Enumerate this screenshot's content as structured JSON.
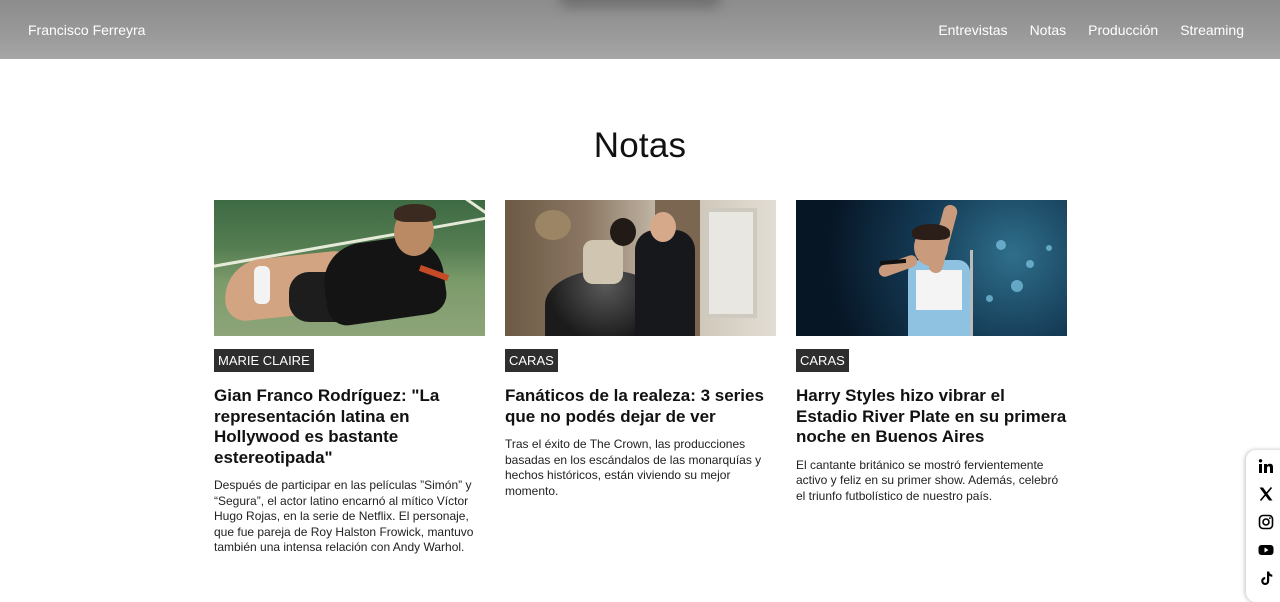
{
  "header": {
    "brand": "Francisco Ferreyra",
    "nav": [
      "Entrevistas",
      "Notas",
      "Producción",
      "Streaming"
    ]
  },
  "section": {
    "title": "Notas"
  },
  "cards": [
    {
      "badge": "MARIE CLAIRE",
      "title": "Gian Franco Rodríguez: \"La representación latina en Hollywood es bastante estereotipada\"",
      "text": "Después de participar en las películas ”Simón” y “Segura”, el actor latino encarnó al mítico Víctor Hugo Rojas, en la serie de Netflix. El personaje, que fue pareja de Roy Halston Frowick, mantuvo también una intensa relación con Andy Warhol."
    },
    {
      "badge": "CARAS",
      "title": "Fanáticos de la realeza: 3 series que no podés dejar de ver",
      "text": "Tras el éxito de The Crown, las producciones basadas en los escándalos de las monarquías y hechos históricos, están viviendo su mejor momento."
    },
    {
      "badge": "CARAS",
      "title": "Harry Styles hizo vibrar el Estadio River Plate en su primera noche en Buenos Aires",
      "text": "El cantante británico se mostró fervientemente activo y feliz en su primer show. Además, celebró el triunfo futbolístico de nuestro país."
    }
  ],
  "social": {
    "icons": [
      "linkedin-icon",
      "x-icon",
      "instagram-icon",
      "youtube-icon",
      "tiktok-icon"
    ]
  },
  "colors": {
    "header_bg": "#999999",
    "badge_bg": "#2e2e2e",
    "text": "#111111"
  }
}
